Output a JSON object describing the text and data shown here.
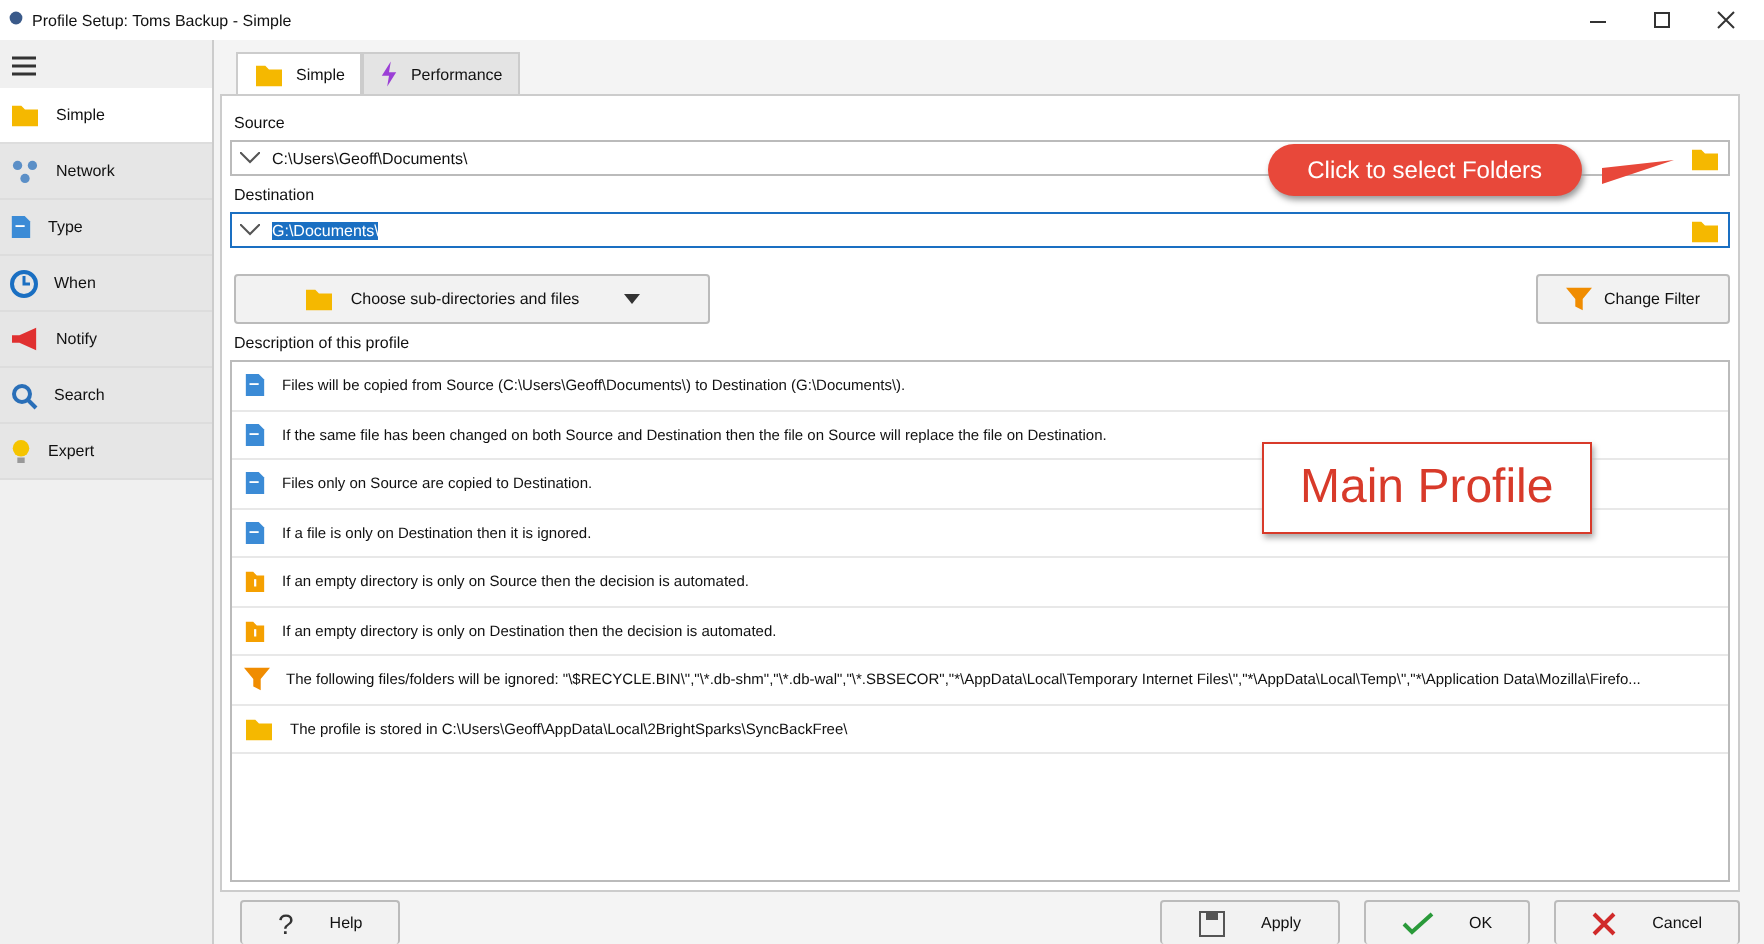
{
  "window": {
    "title": "Profile Setup: Toms Backup - Simple"
  },
  "sidebar": {
    "items": [
      {
        "label": "Simple",
        "kind": "folder",
        "selected": true
      },
      {
        "label": "Network",
        "kind": "network",
        "selected": false
      },
      {
        "label": "Type",
        "kind": "doc",
        "selected": false
      },
      {
        "label": "When",
        "kind": "clock",
        "selected": false
      },
      {
        "label": "Notify",
        "kind": "megaphone",
        "selected": false
      },
      {
        "label": "Search",
        "kind": "search",
        "selected": false
      },
      {
        "label": "Expert",
        "kind": "bulb",
        "selected": false
      }
    ]
  },
  "tabs": [
    {
      "label": "Simple",
      "kind": "folder",
      "selected": true
    },
    {
      "label": "Performance",
      "kind": "bolt",
      "selected": false
    }
  ],
  "source": {
    "label": "Source",
    "value": "C:\\Users\\Geoff\\Documents\\"
  },
  "destination": {
    "label": "Destination",
    "value": "G:\\Documents\\"
  },
  "callout": "Click to select Folders",
  "choose_button": "Choose sub-directories and files",
  "filter_button": "Change Filter",
  "description": {
    "label": "Description of this profile",
    "lines": [
      {
        "kind": "doc",
        "text": "Files will be copied from Source (C:\\Users\\Geoff\\Documents\\) to Destination (G:\\Documents\\)."
      },
      {
        "kind": "doc",
        "text": "If the same file has been changed on both Source and Destination then the file on Source will replace the file on Destination."
      },
      {
        "kind": "doc",
        "text": "Files only on Source are copied to Destination."
      },
      {
        "kind": "doc",
        "text": "If a file is only on Destination then it is ignored."
      },
      {
        "kind": "warning",
        "text": "If an empty directory is only on Source then the decision is automated."
      },
      {
        "kind": "warning",
        "text": "If an empty directory is only on Destination then the decision is automated."
      },
      {
        "kind": "filter",
        "text": "The following files/folders will be ignored: \"\\$RECYCLE.BIN\\\",\"\\*.db-shm\",\"\\*.db-wal\",\"\\*.SBSECOR\",\"*\\AppData\\Local\\Temporary Internet Files\\\",\"*\\AppData\\Local\\Temp\\\",\"*\\Application Data\\Mozilla\\Firefo..."
      },
      {
        "kind": "folder",
        "text": "The profile is stored in C:\\Users\\Geoff\\AppData\\Local\\2BrightSparks\\SyncBackFree\\"
      }
    ]
  },
  "main_label": "Main Profile",
  "buttons": [
    {
      "kind": "help",
      "symbol": "?",
      "label": "Help"
    },
    {
      "kind": "apply",
      "label": "Apply"
    },
    {
      "kind": "ok",
      "label": "OK"
    },
    {
      "kind": "cancel",
      "label": "Cancel"
    }
  ]
}
